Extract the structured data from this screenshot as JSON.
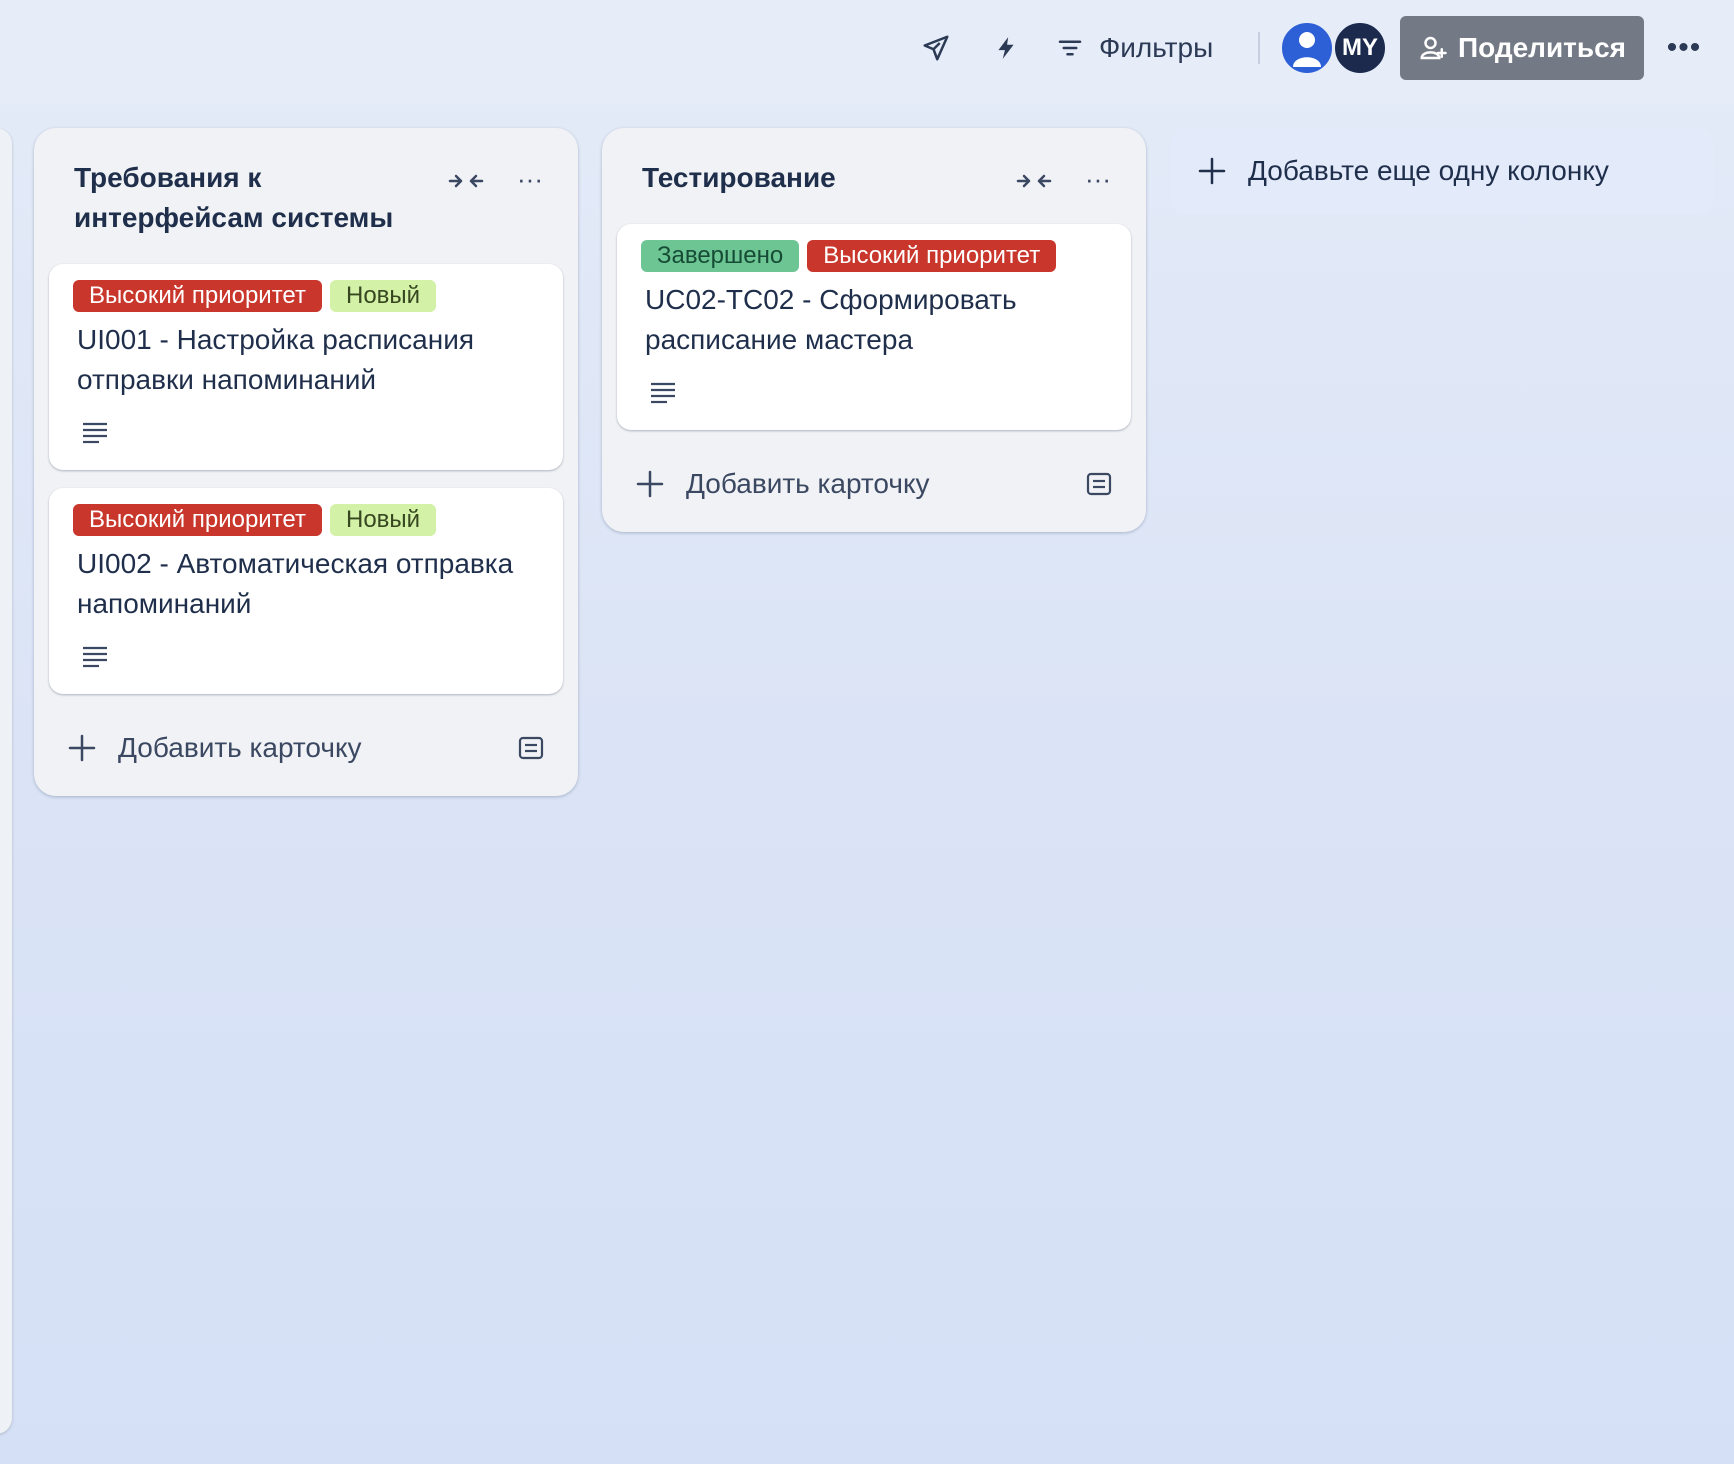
{
  "topbar": {
    "filters_label": "Фильтры",
    "avatar_initials": "MY",
    "share_label": "Поделиться",
    "more_label": "•••"
  },
  "columns": [
    {
      "title": "Требования к интерфейсам системы",
      "more_label": "···",
      "cards": [
        {
          "labels": [
            {
              "text": "Высокий приоритет",
              "bg": "#c9372c",
              "fg": "#ffffff"
            },
            {
              "text": "Новый",
              "bg": "#d3f1a7",
              "fg": "#37471f"
            }
          ],
          "title": "UI001 - Настройка расписания отправки напоминаний",
          "has_description": true
        },
        {
          "labels": [
            {
              "text": "Высокий приоритет",
              "bg": "#c9372c",
              "fg": "#ffffff"
            },
            {
              "text": "Новый",
              "bg": "#d3f1a7",
              "fg": "#37471f"
            }
          ],
          "title": "UI002 - Автоматическая отправка напоминаний",
          "has_description": true
        }
      ],
      "add_card_label": "Добавить карточку"
    },
    {
      "title": "Тестирование",
      "more_label": "···",
      "cards": [
        {
          "labels": [
            {
              "text": "Завершено",
              "bg": "#6cc593",
              "fg": "#164b35"
            },
            {
              "text": "Высокий приоритет",
              "bg": "#c9372c",
              "fg": "#ffffff"
            }
          ],
          "title": "UC02-TC02 - Сформировать расписание мастера",
          "has_description": true
        }
      ],
      "add_card_label": "Добавить карточку"
    }
  ],
  "add_column_label": "Добавьте еще одну колонку"
}
